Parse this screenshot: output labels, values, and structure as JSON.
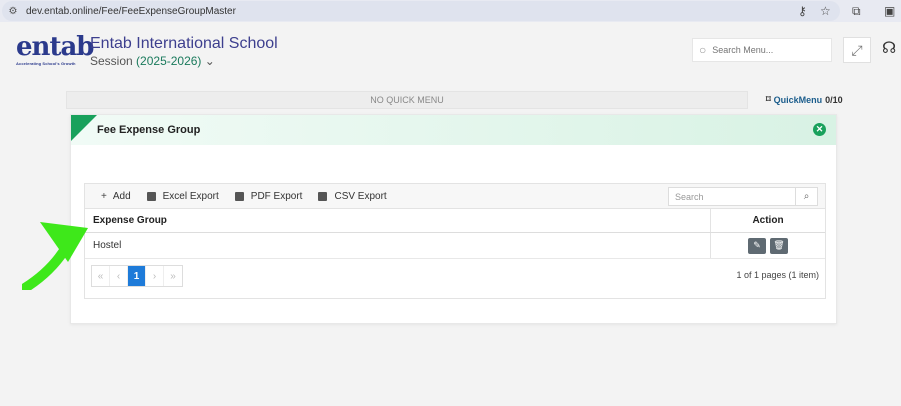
{
  "browser": {
    "url": "dev.entab.online/Fee/FeeExpenseGroupMaster"
  },
  "header": {
    "logo_text": "entab",
    "logo_tagline": "Accelerating School's Growth",
    "school_name": "Entab International School",
    "session_label": "Session",
    "session_year": "(2025-2026)",
    "search_placeholder": "Search Menu..."
  },
  "quick_menu": {
    "bar_text": "NO QUICK MENU",
    "label": "QuickMenu",
    "count": "0/10"
  },
  "card": {
    "title": "Fee Expense Group"
  },
  "toolbar": {
    "add": "Add",
    "excel": "Excel Export",
    "pdf": "PDF Export",
    "csv": "CSV Export",
    "search_placeholder": "Search"
  },
  "table": {
    "columns": [
      "Expense Group",
      "Action"
    ],
    "rows": [
      {
        "expense_group": "Hostel"
      }
    ]
  },
  "pager": {
    "first": "«",
    "prev": "‹",
    "current": "1",
    "next": "›",
    "last": "»",
    "info": "1 of 1 pages (1 item)"
  },
  "colors": {
    "accent_green": "#19a15c",
    "pager_active": "#1e7bd9",
    "annotation_arrow": "#3ee81a"
  }
}
